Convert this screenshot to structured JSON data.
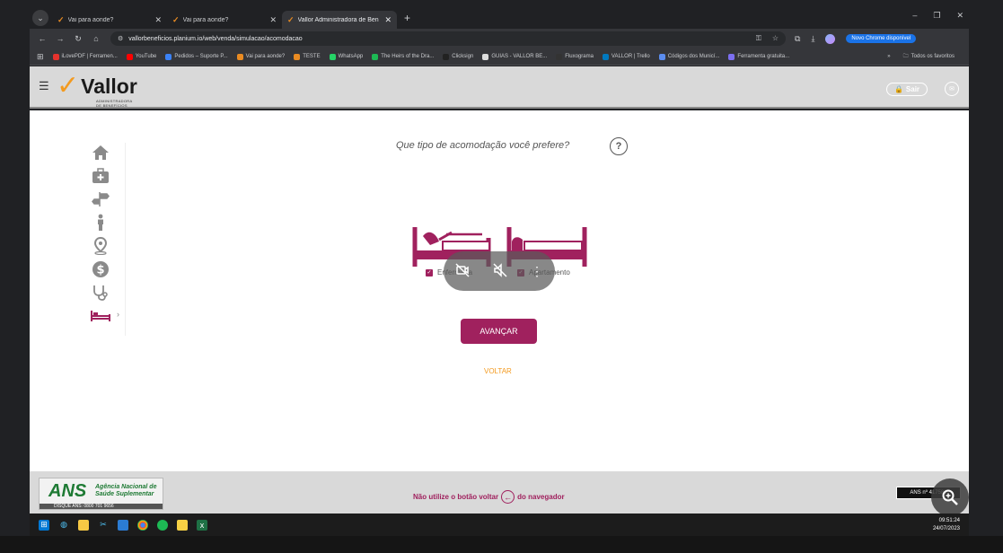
{
  "browser": {
    "tabs": [
      {
        "title": "Vai para aonde?",
        "active": false
      },
      {
        "title": "Vai para aonde?",
        "active": false
      },
      {
        "title": "Vallor Administradora de Benefí",
        "active": true
      }
    ],
    "url": "vallorbeneficios.planium.io/web/venda/simulacao/acomodacao",
    "update_label": "Novo Chrome disponível",
    "bookmarks": [
      {
        "label": "iLovePDF | Ferramen...",
        "color": "#e5322d"
      },
      {
        "label": "YouTube",
        "color": "#ff0000"
      },
      {
        "label": "Pedidos – Suporte P...",
        "color": "#3b82f6"
      },
      {
        "label": "Vai para aonde?",
        "color": "#e98b22"
      },
      {
        "label": "TESTE",
        "color": "#e98b22"
      },
      {
        "label": "WhatsApp",
        "color": "#25d366"
      },
      {
        "label": "The Heirs of the Dra...",
        "color": "#1db954"
      },
      {
        "label": "Clicksign",
        "color": "#222222"
      },
      {
        "label": "GUIAS - VALLOR BE...",
        "color": "#dddddd"
      },
      {
        "label": "Fluxograma",
        "color": "#333333"
      },
      {
        "label": "VALLOR | Trello",
        "color": "#0079bf"
      },
      {
        "label": "Códigos dos Municí...",
        "color": "#5b8def"
      },
      {
        "label": "Ferramenta gratuita...",
        "color": "#7c6ff0"
      }
    ],
    "all_bookmarks_label": "Todos os favoritos"
  },
  "header": {
    "brand": "Vallor",
    "brand_sub": "ADMINISTRADORA DE BENEFÍCIOS",
    "logout_label": "Sair"
  },
  "page": {
    "question": "Que tipo de acomodação você prefere?",
    "help_symbol": "?",
    "options": [
      {
        "label": "Enfermaria",
        "checked": true
      },
      {
        "label": "Apartamento",
        "checked": true
      }
    ],
    "advance_label": "AVANÇAR",
    "back_label": "VOLTAR"
  },
  "footer": {
    "ans_name": "ANS",
    "ans_agency": "Agência Nacional de Saúde Suplementar",
    "ans_phone": "DISQUE ANS: 0800 701 9656",
    "warning_pre": "Não utilize o botão voltar",
    "warning_post": "do navegador",
    "ans_registry": "ANS nº 417581"
  },
  "taskbar": {
    "time": "09:51:24",
    "date": "24/07/2023"
  },
  "colors": {
    "accent": "#a0215e",
    "orange": "#f39a1f"
  }
}
